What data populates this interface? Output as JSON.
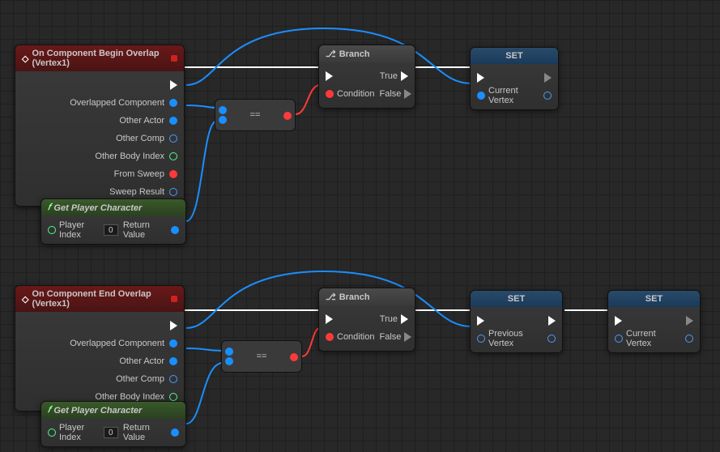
{
  "nodes": {
    "event1": {
      "title": "On Component Begin Overlap (Vertex1)",
      "pins": [
        "Overlapped Component",
        "Other Actor",
        "Other Comp",
        "Other Body Index",
        "From Sweep",
        "Sweep Result"
      ]
    },
    "event2": {
      "title": "On Component End Overlap (Vertex1)",
      "pins": [
        "Overlapped Component",
        "Other Actor",
        "Other Comp",
        "Other Body Index"
      ]
    },
    "getplayer": {
      "title": "Get Player Character",
      "in": "Player Index",
      "inval": "0",
      "out": "Return Value"
    },
    "branch": {
      "title": "Branch",
      "cond": "Condition",
      "t": "True",
      "f": "False"
    },
    "set1": {
      "title": "SET",
      "pin": "Current Vertex"
    },
    "set2": {
      "title": "SET",
      "pin": "Previous Vertex"
    },
    "set3": {
      "title": "SET",
      "pin": "Current Vertex"
    },
    "eq": "=="
  }
}
